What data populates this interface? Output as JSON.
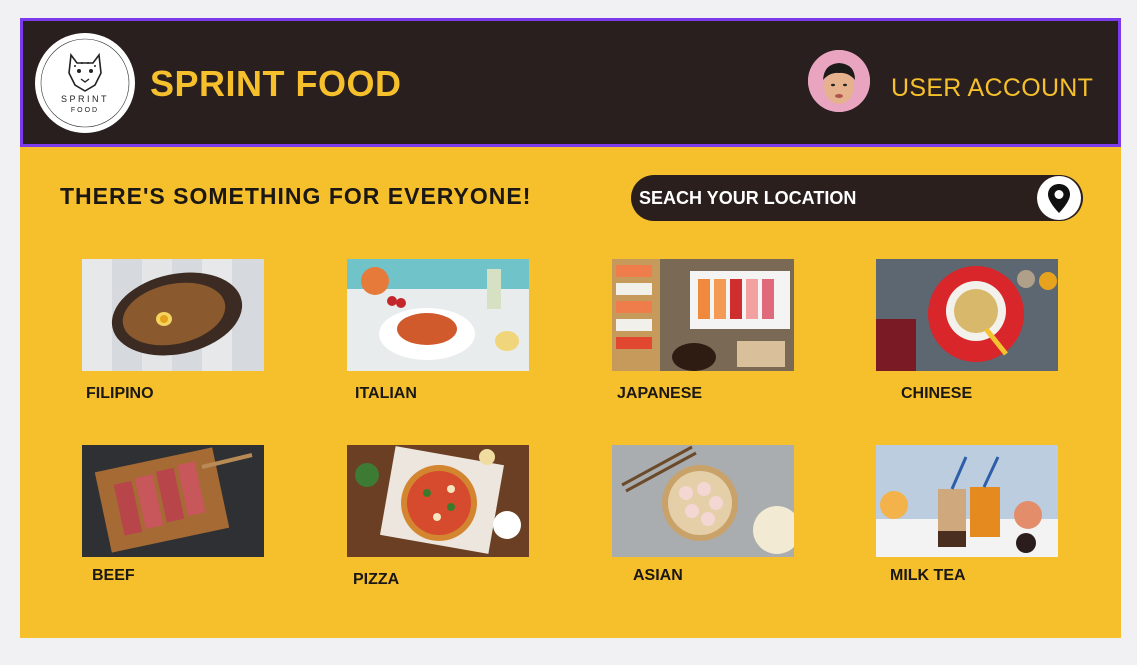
{
  "header": {
    "logo_text_top": "SPRINT",
    "logo_text_bottom": "FOOD",
    "brand": "SPRINT FOOD",
    "account_label": "USER ACCOUNT"
  },
  "main": {
    "tagline": "THERE'S SOMETHING FOR EVERYONE!",
    "search_placeholder": "SEACH YOUR LOCATION"
  },
  "categories": [
    {
      "label": "FILIPINO"
    },
    {
      "label": "ITALIAN"
    },
    {
      "label": "JAPANESE"
    },
    {
      "label": "CHINESE"
    },
    {
      "label": "BEEF"
    },
    {
      "label": "PIZZA"
    },
    {
      "label": "ASIAN"
    },
    {
      "label": "MILK TEA"
    }
  ],
  "colors": {
    "accent": "#f5c02c",
    "header_bg": "#2a1f1f",
    "header_border": "#7c3aed"
  }
}
